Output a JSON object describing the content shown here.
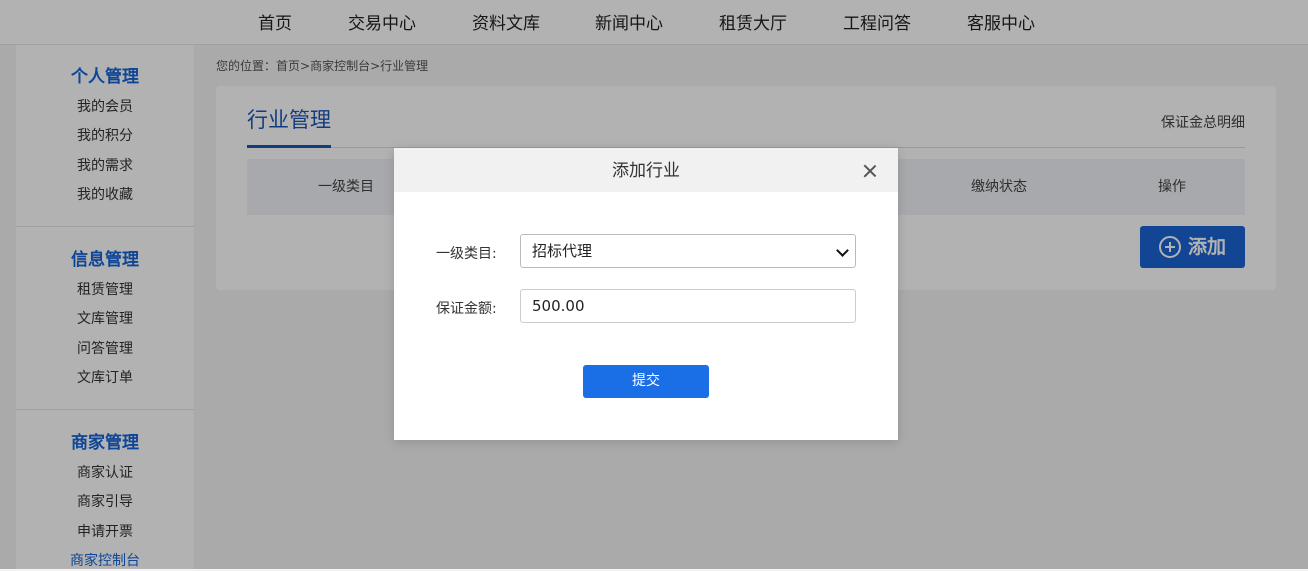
{
  "nav": {
    "items": [
      "首页",
      "交易中心",
      "资料文库",
      "新闻中心",
      "租赁大厅",
      "工程问答",
      "客服中心"
    ]
  },
  "sidebar": {
    "groups": [
      {
        "title": "个人管理",
        "items": [
          "我的会员",
          "我的积分",
          "我的需求",
          "我的收藏"
        ]
      },
      {
        "title": "信息管理",
        "items": [
          "租赁管理",
          "文库管理",
          "问答管理",
          "文库订单"
        ]
      },
      {
        "title": "商家管理",
        "items": [
          "商家认证",
          "商家引导",
          "申请开票",
          "商家控制台"
        ]
      }
    ]
  },
  "breadcrumb": {
    "prefix": "您的位置：",
    "items": [
      "首页",
      "商家控制台",
      "行业管理"
    ],
    "separator": ">"
  },
  "main": {
    "title": "行业管理",
    "deposit_link": "保证金总明细",
    "table_headers": [
      "一级类目",
      "缴纳状态",
      "操作"
    ],
    "add_button_label": "添加"
  },
  "modal": {
    "title": "添加行业",
    "fields": {
      "category_label": "一级类目:",
      "category_value": "招标代理",
      "deposit_label": "保证金额:",
      "deposit_value": "500.00"
    },
    "submit_label": "提交"
  },
  "colors": {
    "accent": "#1565d8",
    "button": "#1b64d4",
    "overlay": "rgba(0,0,0,0.30)"
  },
  "icons": {
    "add_button_icon": "plus-circle-icon",
    "modal_close_icon": "close-icon",
    "select_icon": "chevron-down-icon"
  }
}
